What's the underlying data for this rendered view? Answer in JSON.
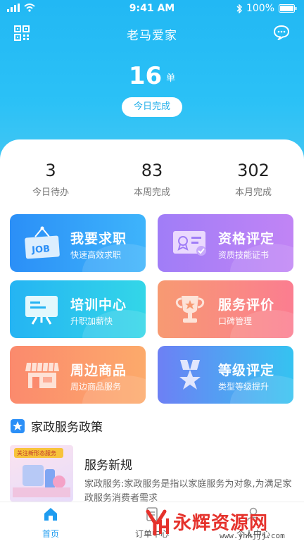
{
  "status_bar": {
    "time": "9:41 AM",
    "battery": "100%"
  },
  "header": {
    "title": "老马爱家"
  },
  "today": {
    "count": "16",
    "unit": "单",
    "button_label": "今日完成"
  },
  "stats": [
    {
      "value": "3",
      "label": "今日待办"
    },
    {
      "value": "83",
      "label": "本周完成"
    },
    {
      "value": "302",
      "label": "本月完成"
    }
  ],
  "tiles": [
    {
      "title": "我要求职",
      "subtitle": "快速高效求职",
      "icon_text": "JOB"
    },
    {
      "title": "资格评定",
      "subtitle": "资质技能证书"
    },
    {
      "title": "培训中心",
      "subtitle": "升职加薪快"
    },
    {
      "title": "服务评价",
      "subtitle": "口碑管理"
    },
    {
      "title": "周边商品",
      "subtitle": "周边商品服务"
    },
    {
      "title": "等级评定",
      "subtitle": "类型等级提升"
    }
  ],
  "policy": {
    "section_title": "家政服务政策",
    "news": {
      "thumb_caption": "关注新形态服务",
      "title": "服务新规",
      "description": "家政服务:家政服务是指以家庭服务为对象,为满足家政服务消费者需求"
    }
  },
  "tabbar": {
    "items": [
      {
        "label": "首页",
        "active": true
      },
      {
        "label": "订单中心"
      },
      {
        "label": "个人中心"
      }
    ]
  },
  "watermark": {
    "text": "永辉资源网",
    "url": "www.yhkjjj.com"
  },
  "colors": {
    "primary": "#22b8f4",
    "tab_active": "#1f9cf0",
    "watermark": "#e5322c"
  }
}
